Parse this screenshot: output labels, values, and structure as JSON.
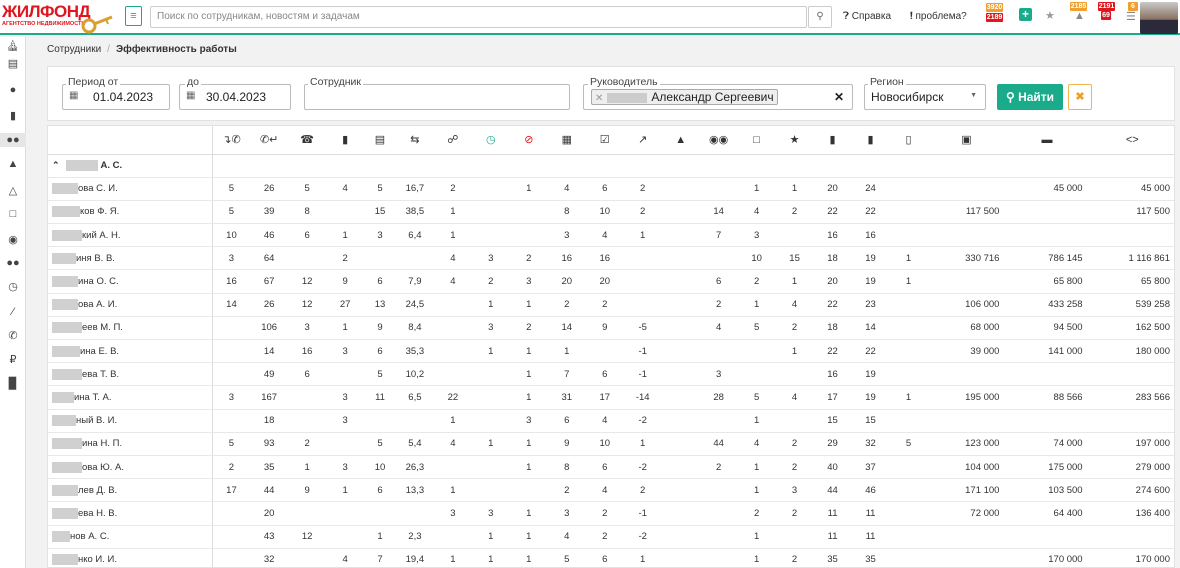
{
  "header": {
    "logo_text": "ЖИЛФОНД",
    "logo_subtext": "АГЕНТСТВО НЕДВИЖИМОСТИ",
    "search_placeholder": "Поиск по сотрудникам, новостям и задачам",
    "help_label": "Справка",
    "problem_label": "проблема?",
    "badges": {
      "problem_top": "3920",
      "problem_bottom": "2189",
      "b1": "2185",
      "b2": "2191",
      "b2_sub": "69",
      "b3": "6"
    },
    "accent_color": "#1aab8b",
    "brand_color": "#e0161e"
  },
  "sidebar": {
    "icons": [
      "home-icon",
      "list-icon",
      "user-icon",
      "document-icon",
      "users-icon",
      "graduation-icon",
      "org-structure-icon",
      "bank-icon",
      "info-icon",
      "group-icon",
      "clock-icon",
      "wrench-icon",
      "phone-icon",
      "ruble-icon",
      "chart-icon"
    ]
  },
  "breadcrumb": {
    "parent": "Сотрудники",
    "current": "Эффективность работы"
  },
  "filters": {
    "period_from_label": "Период от",
    "period_from_value": "01.04.2023",
    "period_to_label": "до",
    "period_to_value": "30.04.2023",
    "employee_label": "Сотрудник",
    "employee_value": "",
    "manager_label": "Руководитель",
    "manager_value": "Александр Сергеевич",
    "region_label": "Регион",
    "region_value": "Новосибирск",
    "find_label": "Найти"
  },
  "table": {
    "columns": [
      "",
      "outgoing-call-icon",
      "incoming-call-icon",
      "phone-icon",
      "bookmark-icon",
      "list-icon",
      "exchange-icon",
      "link-icon",
      "clock-green-icon",
      "blocked-red-icon",
      "calendar-icon",
      "calendar-check-icon",
      "chart-line-icon",
      "thumbs-up-icon",
      "binoculars-icon",
      "bank-icon",
      "trophy-icon",
      "building-icon",
      "building-alt-icon",
      "document-icon",
      "money-icon",
      "card-icon",
      "code-icon"
    ],
    "group_label": "А. С.",
    "rows": [
      {
        "name": "ова С. И.",
        "cells": [
          "5",
          "26",
          "5",
          "4",
          "5",
          "16,7",
          "2",
          "",
          "1",
          "4",
          "6",
          "2",
          "",
          "",
          "1",
          "1",
          "20",
          "24",
          "",
          "",
          "45 000",
          "45 000"
        ]
      },
      {
        "name": "ков Ф. Я.",
        "cells": [
          "5",
          "39",
          "8",
          "",
          "15",
          "38,5",
          "1",
          "",
          "",
          "8",
          "10",
          "2",
          "",
          "14",
          "4",
          "2",
          "22",
          "22",
          "",
          "117 500",
          "",
          "117 500"
        ]
      },
      {
        "name": "кий А. Н.",
        "cells": [
          "10",
          "46",
          "6",
          "1",
          "3",
          "6,4",
          "1",
          "",
          "",
          "3",
          "4",
          "1",
          "",
          "7",
          "3",
          "",
          "16",
          "16",
          "",
          "",
          "",
          ""
        ]
      },
      {
        "name": "иня В. В.",
        "cells": [
          "3",
          "64",
          "",
          "2",
          "",
          "",
          "4",
          "3",
          "2",
          "16",
          "16",
          "",
          "",
          "",
          "10",
          "15",
          "18",
          "19",
          "1",
          "330 716",
          "786 145",
          "1 116 861"
        ]
      },
      {
        "name": "ина О. С.",
        "cells": [
          "16",
          "67",
          "12",
          "9",
          "6",
          "7,9",
          "4",
          "2",
          "3",
          "20",
          "20",
          "",
          "",
          "6",
          "2",
          "1",
          "20",
          "19",
          "1",
          "",
          "65 800",
          "65 800"
        ]
      },
      {
        "name": "ова А. И.",
        "cells": [
          "14",
          "26",
          "12",
          "27",
          "13",
          "24,5",
          "",
          "1",
          "1",
          "2",
          "2",
          "",
          "",
          "2",
          "1",
          "4",
          "22",
          "23",
          "",
          "106 000",
          "433 258",
          "539 258"
        ]
      },
      {
        "name": "еев М. П.",
        "cells": [
          "",
          "106",
          "3",
          "1",
          "9",
          "8,4",
          "",
          "3",
          "2",
          "14",
          "9",
          "-5",
          "",
          "4",
          "5",
          "2",
          "18",
          "14",
          "",
          "68 000",
          "94 500",
          "162 500"
        ]
      },
      {
        "name": "ина Е. В.",
        "cells": [
          "",
          "14",
          "16",
          "3",
          "6",
          "35,3",
          "",
          "1",
          "1",
          "1",
          "",
          "-1",
          "",
          "",
          "",
          "1",
          "22",
          "22",
          "",
          "39 000",
          "141 000",
          "180 000"
        ]
      },
      {
        "name": "ева Т. В.",
        "cells": [
          "",
          "49",
          "6",
          "",
          "5",
          "10,2",
          "",
          "",
          "1",
          "7",
          "6",
          "-1",
          "",
          "3",
          "",
          "",
          "16",
          "19",
          "",
          "",
          "",
          ""
        ]
      },
      {
        "name": "ина Т. А.",
        "cells": [
          "3",
          "167",
          "",
          "3",
          "11",
          "6,5",
          "22",
          "",
          "1",
          "31",
          "17",
          "-14",
          "",
          "28",
          "5",
          "4",
          "17",
          "19",
          "1",
          "195 000",
          "88 566",
          "283 566"
        ]
      },
      {
        "name": "ный В. И.",
        "cells": [
          "",
          "18",
          "",
          "3",
          "",
          "",
          "1",
          "",
          "3",
          "6",
          "4",
          "-2",
          "",
          "",
          "1",
          "",
          "15",
          "15",
          "",
          "",
          "",
          ""
        ]
      },
      {
        "name": "ина Н. П.",
        "cells": [
          "5",
          "93",
          "2",
          "",
          "5",
          "5,4",
          "4",
          "1",
          "1",
          "9",
          "10",
          "1",
          "",
          "44",
          "4",
          "2",
          "29",
          "32",
          "5",
          "123 000",
          "74 000",
          "197 000"
        ]
      },
      {
        "name": "ова Ю. А.",
        "cells": [
          "2",
          "35",
          "1",
          "3",
          "10",
          "26,3",
          "",
          "",
          "1",
          "8",
          "6",
          "-2",
          "",
          "2",
          "1",
          "2",
          "40",
          "37",
          "",
          "104 000",
          "175 000",
          "279 000"
        ]
      },
      {
        "name": "лев Д. В.",
        "cells": [
          "17",
          "44",
          "9",
          "1",
          "6",
          "13,3",
          "1",
          "",
          "",
          "2",
          "4",
          "2",
          "",
          "",
          "1",
          "3",
          "44",
          "46",
          "",
          "171 100",
          "103 500",
          "274 600"
        ]
      },
      {
        "name": "ева Н. В.",
        "cells": [
          "",
          "20",
          "",
          "",
          "",
          "",
          "3",
          "3",
          "1",
          "3",
          "2",
          "-1",
          "",
          "",
          "2",
          "2",
          "11",
          "11",
          "",
          "72 000",
          "64 400",
          "136 400"
        ]
      },
      {
        "name": "нов А. С.",
        "cells": [
          "",
          "43",
          "12",
          "",
          "1",
          "2,3",
          "",
          "1",
          "1",
          "4",
          "2",
          "-2",
          "",
          "",
          "1",
          "",
          "11",
          "11",
          "",
          "",
          "",
          ""
        ]
      },
      {
        "name": "нко И. И.",
        "cells": [
          "",
          "32",
          "",
          "4",
          "7",
          "19,4",
          "1",
          "1",
          "1",
          "5",
          "6",
          "1",
          "",
          "",
          "1",
          "2",
          "35",
          "35",
          "",
          "",
          "170 000",
          "170 000"
        ]
      }
    ]
  }
}
